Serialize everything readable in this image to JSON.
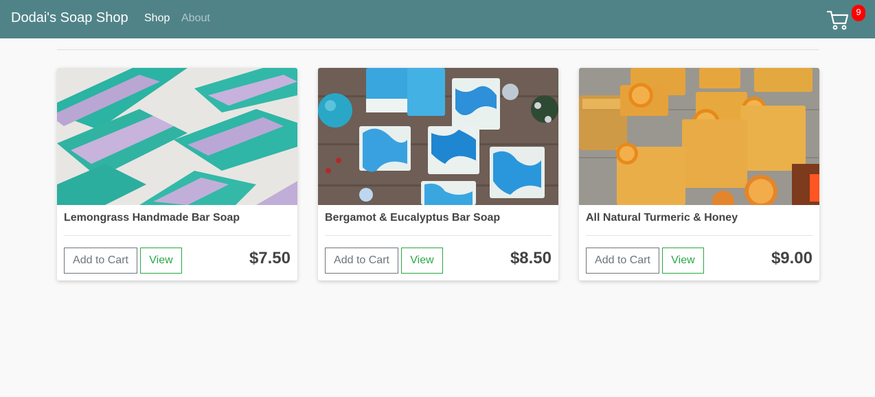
{
  "header": {
    "brand": "Dodai's Soap Shop",
    "nav": {
      "shop": "Shop",
      "about": "About"
    },
    "cart_icon": "shopping-cart-icon",
    "cart_count": "9"
  },
  "colors": {
    "navbar": "#508388",
    "badge": "#ff0000",
    "view_button": "#28a745",
    "add_button": "#6c757d"
  },
  "products": [
    {
      "name": "Lemongrass Handmade Bar Soap",
      "price": "$7.50",
      "add_label": "Add to Cart",
      "view_label": "View"
    },
    {
      "name": "Bergamot & Eucalyptus Bar Soap",
      "price": "$8.50",
      "add_label": "Add to Cart",
      "view_label": "View"
    },
    {
      "name": "All Natural Turmeric & Honey",
      "price": "$9.00",
      "add_label": "Add to Cart",
      "view_label": "View"
    }
  ]
}
